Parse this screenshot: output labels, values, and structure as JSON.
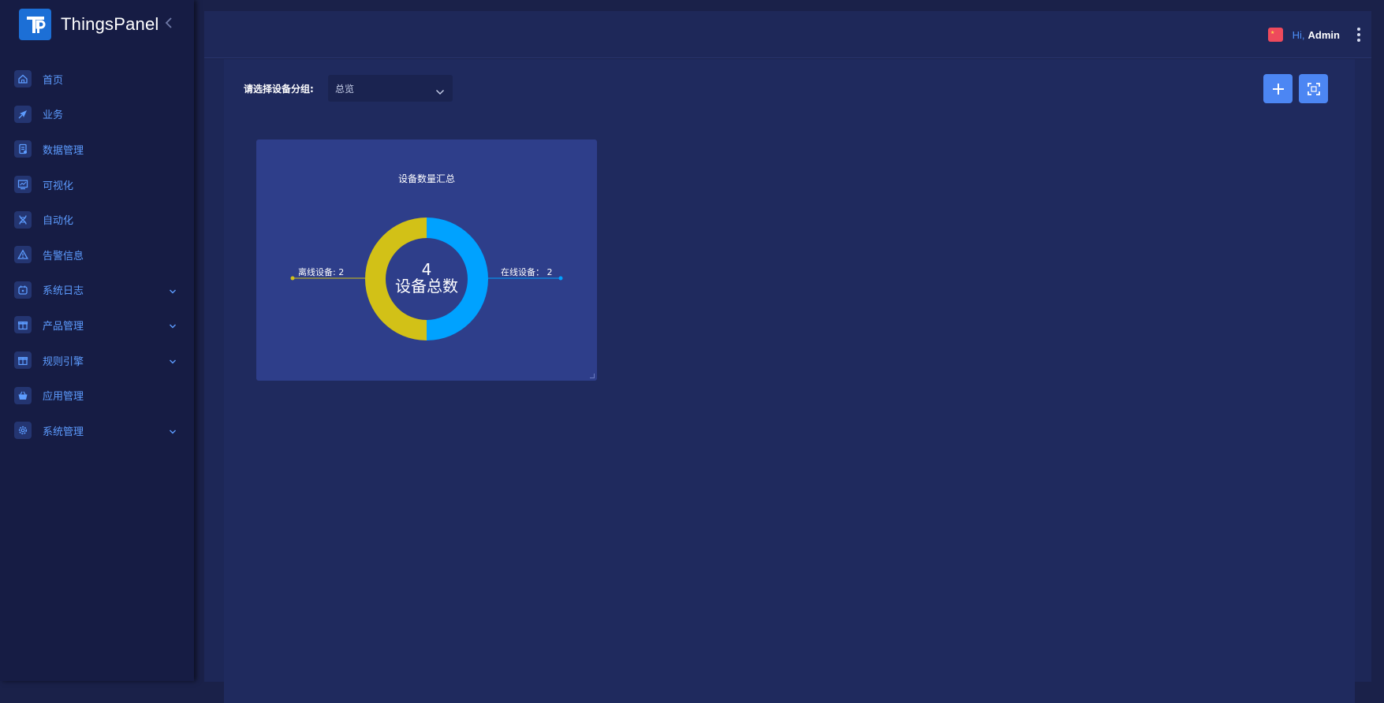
{
  "app": {
    "name": "ThingsPanel"
  },
  "sidebar": {
    "items": [
      {
        "label": "首页",
        "icon": "home-icon",
        "has_children": false
      },
      {
        "label": "业务",
        "icon": "compass-icon",
        "has_children": false
      },
      {
        "label": "数据管理",
        "icon": "document-icon",
        "has_children": false
      },
      {
        "label": "可视化",
        "icon": "monitor-chart-icon",
        "has_children": false
      },
      {
        "label": "自动化",
        "icon": "dna-icon",
        "has_children": false
      },
      {
        "label": "告警信息",
        "icon": "warning-icon",
        "has_children": false
      },
      {
        "label": "系统日志",
        "icon": "log-icon",
        "has_children": true
      },
      {
        "label": "产品管理",
        "icon": "gift-icon",
        "has_children": true
      },
      {
        "label": "规则引擎",
        "icon": "gift-icon",
        "has_children": true
      },
      {
        "label": "应用管理",
        "icon": "basket-icon",
        "has_children": false
      },
      {
        "label": "系统管理",
        "icon": "gear-icon",
        "has_children": true
      }
    ]
  },
  "header": {
    "greeting": "Hi,",
    "user": "Admin"
  },
  "toolbar": {
    "group_label": "请选择设备分组:",
    "group_selected": "总览"
  },
  "widget": {
    "title": "设备数量汇总",
    "center_value": "4",
    "center_label": "设备总数",
    "offline_label": "离线设备: 2",
    "online_label": "在线设备： 2"
  },
  "chart_data": {
    "type": "pie",
    "title": "设备数量汇总",
    "categories": [
      "在线设备",
      "离线设备"
    ],
    "values": [
      2,
      2
    ],
    "colors": [
      "#00a2ff",
      "#d2c117"
    ],
    "total": 4
  }
}
